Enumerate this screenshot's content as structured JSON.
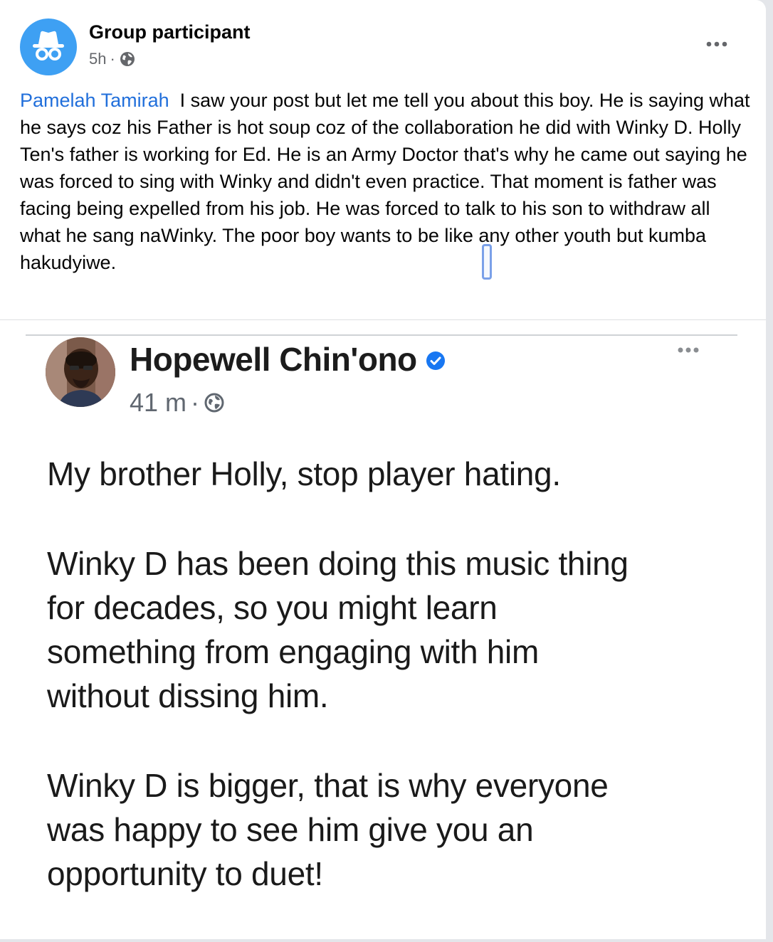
{
  "post": {
    "author": "Group participant",
    "timestamp": "5h",
    "separator": "·",
    "privacy_icon": "globe-icon",
    "more_icon": "more-horizontal-icon",
    "mention": "Pamelah Tamirah",
    "body": "I saw your post but let me tell you about this boy. He is saying what he says coz his Father is hot soup coz of the collaboration he did with Winky D. Holly Ten's father is working for Ed.  He is an Army Doctor that's why he came out saying he was forced to sing with Winky and didn't even practice.  That moment is father was facing being expelled from his job. He was forced to talk to his son to withdraw all what he sang naWinky. The poor boy wants to be like any other youth but kumba hakudyiwe."
  },
  "shared_post": {
    "author": "Hopewell Chin'ono",
    "verified_icon": "verified-badge-icon",
    "timestamp": "41 m",
    "separator": "·",
    "privacy_icon": "globe-icon",
    "more_icon": "more-horizontal-icon",
    "paragraphs": [
      "My brother Holly, stop player hating.",
      "Winky D has been doing this music thing\nfor decades, so you might learn\nsomething from engaging with him\nwithout dissing him.",
      "Winky D is bigger, that is why everyone\nwas happy to see him give you an\nopportunity to duet!"
    ]
  },
  "colors": {
    "mention": "#216fdb",
    "avatar_bg": "#3ea0f3",
    "verified": "#1877f2"
  }
}
